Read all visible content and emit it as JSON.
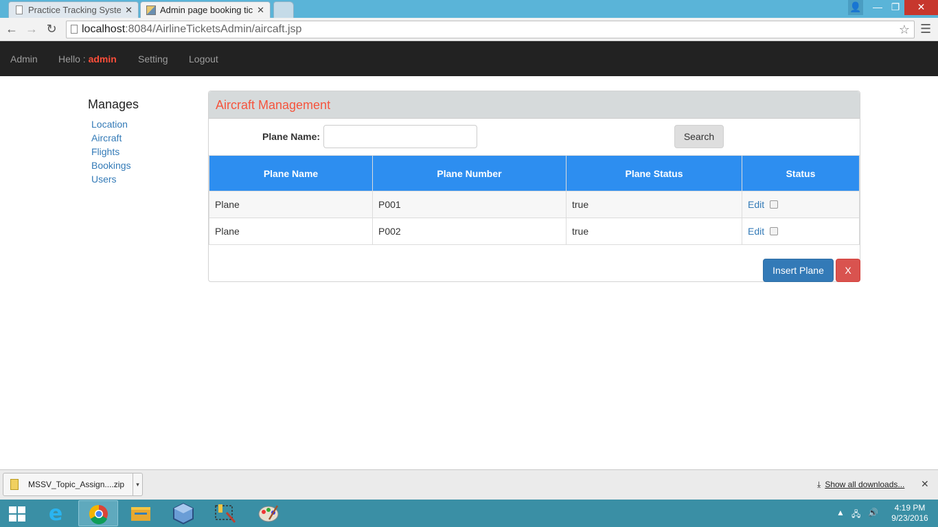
{
  "browser": {
    "tabs": [
      {
        "title": "Practice Tracking System",
        "active": false
      },
      {
        "title": "Admin page booking ticke",
        "active": true
      }
    ],
    "url_host": "localhost",
    "url_rest": ":8084/AirlineTicketsAdmin/aircaft.jsp"
  },
  "navbar": {
    "brand": "Admin",
    "hello_label": "Hello :",
    "username": "admin",
    "setting": "Setting",
    "logout": "Logout"
  },
  "sidebar": {
    "title": "Manages",
    "items": [
      {
        "label": "Location"
      },
      {
        "label": "Aircraft"
      },
      {
        "label": "Flights"
      },
      {
        "label": "Bookings"
      },
      {
        "label": "Users"
      }
    ]
  },
  "panel": {
    "title": "Aircraft Management",
    "search_label": "Plane Name:",
    "search_value": "",
    "search_button": "Search",
    "insert_button": "Insert Plane",
    "close_button": "X"
  },
  "table": {
    "headers": [
      "Plane Name",
      "Plane Number",
      "Plane Status",
      "Status"
    ],
    "rows": [
      {
        "name": "Plane",
        "number": "P001",
        "status": "true",
        "action": "Edit",
        "checked": false
      },
      {
        "name": "Plane",
        "number": "P002",
        "status": "true",
        "action": "Edit",
        "checked": false
      }
    ]
  },
  "downloads": {
    "item": "MSSV_Topic_Assign....zip",
    "show_all": "Show all downloads..."
  },
  "taskbar": {
    "time": "4:19 PM",
    "date": "9/23/2016"
  },
  "colors": {
    "navbar_bg": "#222222",
    "username": "#ff4e3a",
    "panel_title": "#f5543d",
    "table_header": "#2d8ef0",
    "link": "#337ab7",
    "insert_button": "#337ab7",
    "close_button": "#d9534f"
  }
}
